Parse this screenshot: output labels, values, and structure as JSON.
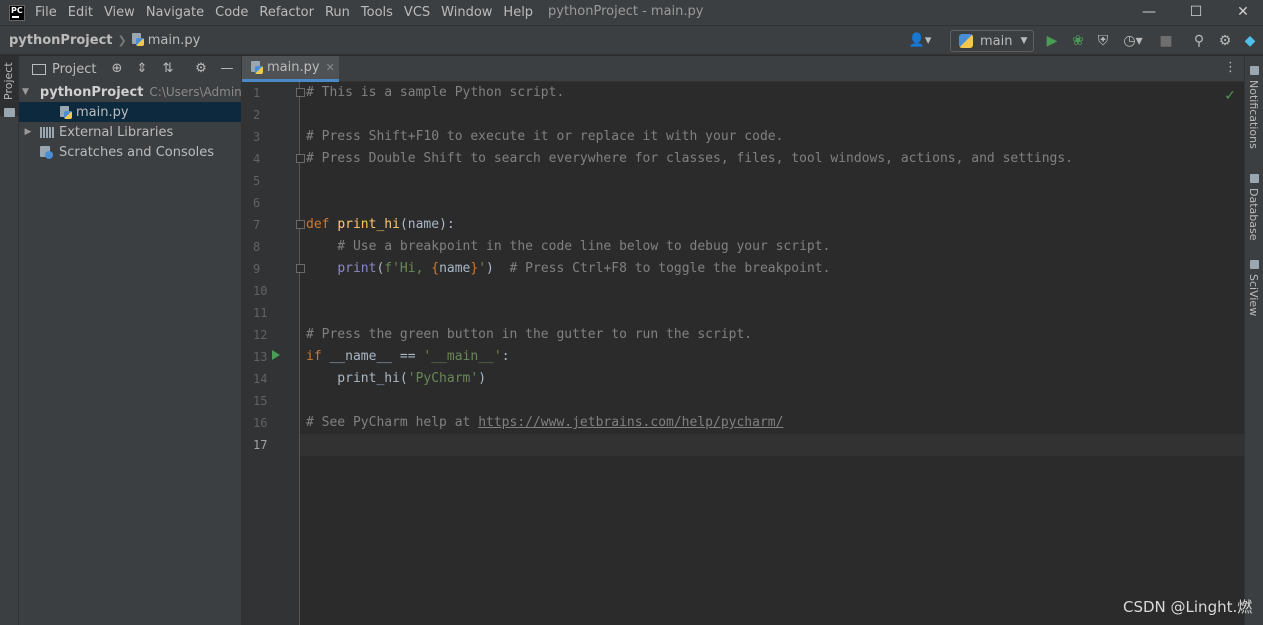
{
  "app": {
    "logo_text": "PC",
    "window_title": "pythonProject - main.py"
  },
  "menu": [
    "File",
    "Edit",
    "View",
    "Navigate",
    "Code",
    "Refactor",
    "Run",
    "Tools",
    "VCS",
    "Window",
    "Help"
  ],
  "breadcrumb": {
    "project": "pythonProject",
    "file": "main.py"
  },
  "run_config": {
    "label": "main"
  },
  "project_panel": {
    "title": "Project",
    "tree": {
      "root_name": "pythonProject",
      "root_path": "C:\\Users\\Admin",
      "file": "main.py",
      "libs": "External Libraries",
      "scratches": "Scratches and Consoles"
    }
  },
  "left_strip": {
    "project": "Project"
  },
  "editor": {
    "tab_label": "main.py",
    "line_numbers": [
      "1",
      "2",
      "3",
      "4",
      "5",
      "6",
      "7",
      "8",
      "9",
      "10",
      "11",
      "12",
      "13",
      "14",
      "15",
      "16",
      "17"
    ],
    "code": {
      "l1": "# This is a sample Python script.",
      "l3": "# Press Shift+F10 to execute it or replace it with your code.",
      "l4": "# Press Double Shift to search everywhere for classes, files, tool windows, actions, and settings.",
      "l7_def": "def",
      "l7_fn": "print_hi",
      "l7_rest": "(name):",
      "l8": "    # Use a breakpoint in the code line below to debug your script.",
      "l9_indent": "    ",
      "l9_print": "print",
      "l9_open": "(",
      "l9_fstr1": "f'Hi, ",
      "l9_brace1": "{",
      "l9_name": "name",
      "l9_brace2": "}",
      "l9_fstr2": "'",
      "l9_close": ")  ",
      "l9_comment": "# Press Ctrl+F8 to toggle the breakpoint.",
      "l12": "# Press the green button in the gutter to run the script.",
      "l13_if": "if",
      "l13_mid": " __name__ == ",
      "l13_str": "'__main__'",
      "l13_end": ":",
      "l14_indent": "    print_hi(",
      "l14_str": "'PyCharm'",
      "l14_end": ")",
      "l16_text": "# See PyCharm help at ",
      "l16_link": "https://www.jetbrains.com/help/pycharm/"
    }
  },
  "right_strip": {
    "notifications": "Notifications",
    "database": "Database",
    "sciview": "SciView"
  },
  "watermark": "CSDN @Linght.燃",
  "colors": {
    "editor_bg": "#2b2b2b",
    "panel_bg": "#3c3f41",
    "selection": "#0d293e",
    "accent": "#4a88c7",
    "run_green": "#499c54"
  }
}
